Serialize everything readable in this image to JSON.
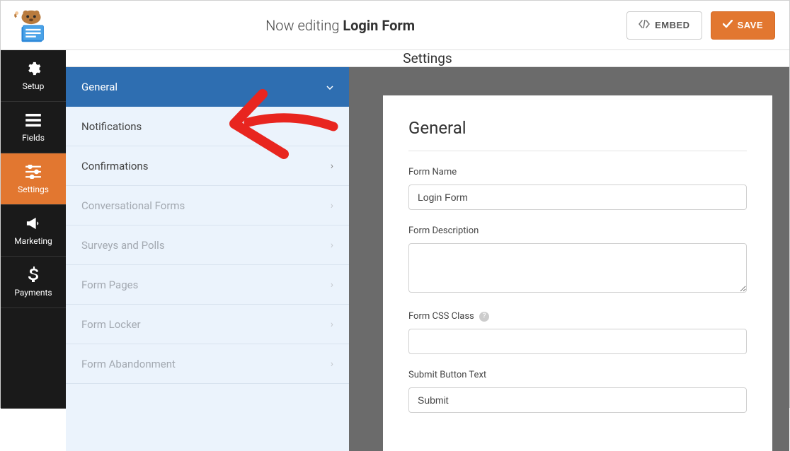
{
  "header": {
    "editing_prefix": "Now editing ",
    "form_name": "Login Form",
    "embed_label": "EMBED",
    "save_label": "SAVE"
  },
  "nav": {
    "items": [
      {
        "label": "Setup"
      },
      {
        "label": "Fields"
      },
      {
        "label": "Settings"
      },
      {
        "label": "Marketing"
      },
      {
        "label": "Payments"
      }
    ]
  },
  "sub_header": "Settings",
  "settings_list": {
    "items": [
      {
        "label": "General"
      },
      {
        "label": "Notifications"
      },
      {
        "label": "Confirmations"
      },
      {
        "label": "Conversational Forms"
      },
      {
        "label": "Surveys and Polls"
      },
      {
        "label": "Form Pages"
      },
      {
        "label": "Form Locker"
      },
      {
        "label": "Form Abandonment"
      }
    ]
  },
  "panel": {
    "title": "General",
    "form_name_label": "Form Name",
    "form_name_value": "Login Form",
    "form_description_label": "Form Description",
    "form_description_value": "",
    "form_css_class_label": "Form CSS Class",
    "form_css_class_value": "",
    "submit_button_text_label": "Submit Button Text",
    "submit_button_text_value": "Submit"
  }
}
